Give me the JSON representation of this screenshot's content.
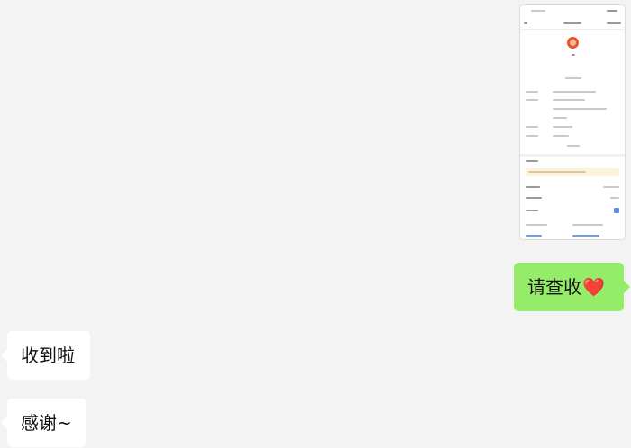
{
  "messages": [
    {
      "id": "msg-check",
      "side": "sent",
      "text": "请查收",
      "emoji": "❤️"
    },
    {
      "id": "msg-received",
      "side": "received",
      "text": "收到啦"
    },
    {
      "id": "msg-thanks",
      "side": "received",
      "text": "感谢~"
    }
  ],
  "colors": {
    "background": "#f3f3f3",
    "sent_bubble": "#95ec69",
    "received_bubble": "#ffffff",
    "heart": "#ff4d6d"
  },
  "icons": {
    "heart": "heart-emoji",
    "thumbnail_logo": "brand-logo-icon"
  }
}
